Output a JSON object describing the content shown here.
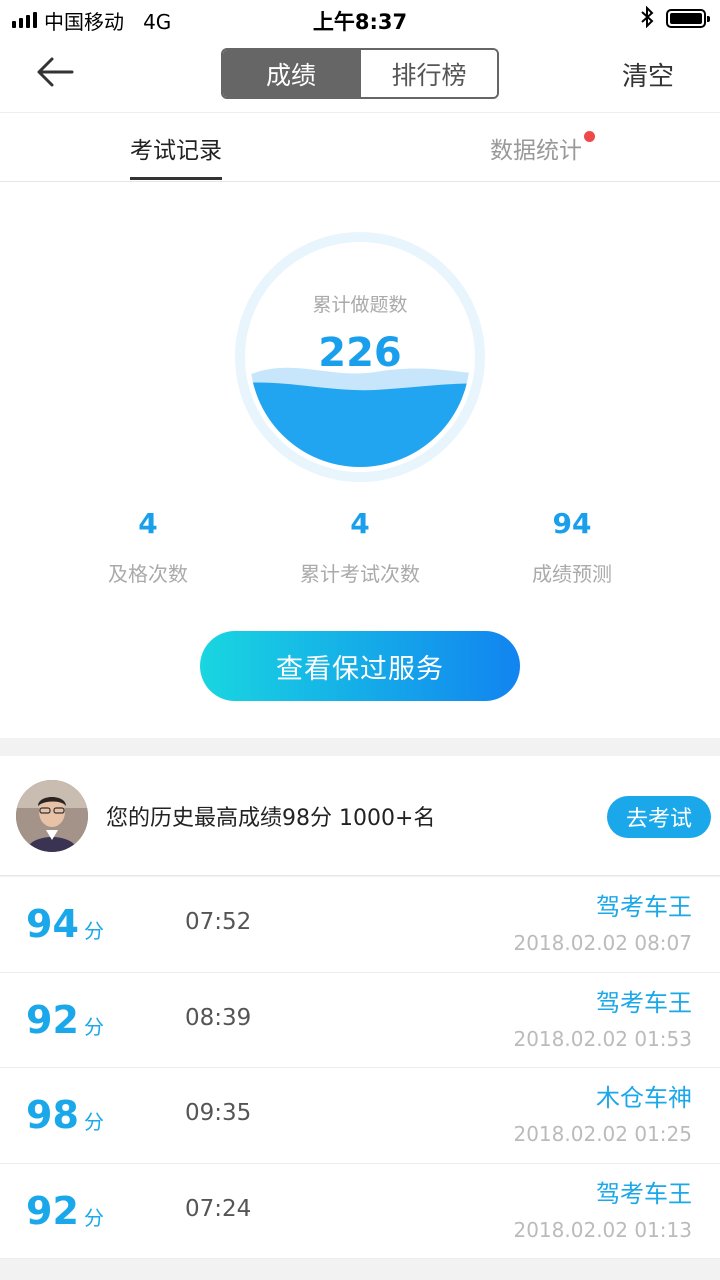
{
  "status_bar": {
    "carrier": "中国移动",
    "network": "4G",
    "time": "上午8:37"
  },
  "nav": {
    "segments": [
      "成绩",
      "排行榜"
    ],
    "active_segment": "成绩",
    "clear_label": "清空"
  },
  "tabs": [
    {
      "label": "考试记录",
      "active": true
    },
    {
      "label": "数据统计",
      "badge": true
    }
  ],
  "summary": {
    "gauge_label": "累计做题数",
    "gauge_value": "226",
    "stats": [
      {
        "value": "4",
        "label": "及格次数"
      },
      {
        "value": "4",
        "label": "累计考试次数"
      },
      {
        "value": "94",
        "label": "成绩预测"
      }
    ],
    "service_button": "查看保过服务"
  },
  "best": {
    "text": "您的历史最高成绩98分 1000+名",
    "exam_button": "去考试"
  },
  "records": [
    {
      "score": "94",
      "unit": "分",
      "duration": "07:52",
      "name": "驾考车王",
      "date": "2018.02.02 08:07"
    },
    {
      "score": "92",
      "unit": "分",
      "duration": "08:39",
      "name": "驾考车王",
      "date": "2018.02.02 01:53"
    },
    {
      "score": "98",
      "unit": "分",
      "duration": "09:35",
      "name": "木仓车神",
      "date": "2018.02.02 01:25"
    },
    {
      "score": "92",
      "unit": "分",
      "duration": "07:24",
      "name": "驾考车王",
      "date": "2018.02.02 01:13"
    }
  ],
  "colors": {
    "accent": "#1aa8ea",
    "gauge_fill": "#22a5f1",
    "badge": "#f04848"
  },
  "icons": [
    "back-arrow-icon",
    "bluetooth-icon",
    "battery-icon",
    "signal-icon"
  ]
}
